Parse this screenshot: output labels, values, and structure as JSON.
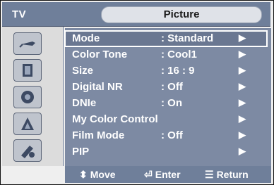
{
  "header": {
    "device_label": "TV",
    "menu_title": "Picture"
  },
  "sidebar": {
    "icons": [
      "antenna-icon",
      "picture-icon",
      "speaker-icon",
      "satellite-icon",
      "tools-icon"
    ]
  },
  "menu": {
    "items": [
      {
        "label": "Mode",
        "value": ": Standard",
        "arrow": "▶"
      },
      {
        "label": "Color Tone",
        "value": ": Cool1",
        "arrow": "▶"
      },
      {
        "label": "Size",
        "value": ": 16 : 9",
        "arrow": "▶"
      },
      {
        "label": "Digital NR",
        "value": ": Off",
        "arrow": "▶"
      },
      {
        "label": "DNIe",
        "value": ": On",
        "arrow": "▶"
      },
      {
        "label": "My Color Control",
        "value": "",
        "arrow": "▶"
      },
      {
        "label": "Film Mode",
        "value": ": Off",
        "arrow": "▶"
      },
      {
        "label": "PIP",
        "value": "",
        "arrow": "▶"
      }
    ]
  },
  "footer": {
    "move_icon": "⬍",
    "move_label": "Move",
    "enter_icon": "⏎",
    "enter_label": "Enter",
    "return_icon": "☰",
    "return_label": "Return"
  }
}
